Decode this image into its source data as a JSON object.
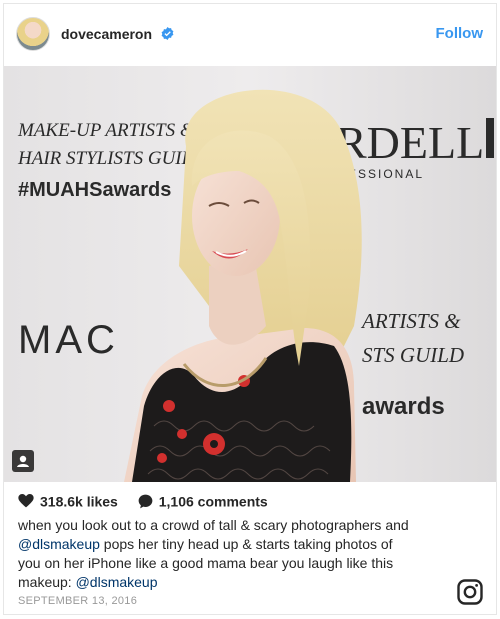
{
  "post": {
    "username": "dovecameron",
    "follow_label": "Follow",
    "likes": "318.6k likes",
    "comments": "1,106 comments",
    "caption_line_1": "when you look out to a crowd of tall & scary photographers and",
    "caption_mention_1": "@dlsmakeup",
    "caption_line_2": " pops her tiny head up & starts taking photos of",
    "caption_line_3": "you on her iPhone like a good mama bear you laugh like this",
    "caption_line_4_prefix": "makeup: ",
    "caption_mention_2": "@dlsmakeup",
    "date": "SEPTEMBER 13, 2016"
  },
  "photo_backdrop": {
    "left_text_1": "MAKE-UP ARTISTS &",
    "left_text_2": "HAIR STYLISTS GUILD",
    "left_text_3": "#MUAHSawards",
    "mac_text": "MAC",
    "top_right_text": "RDELL",
    "top_right_sub": "ESSIONAL",
    "right_text_1": "ARTISTS &",
    "right_text_2": "STS GUILD",
    "right_text_3": "awards"
  },
  "icons": {
    "verified": "verified-badge-icon",
    "heart": "heart-icon",
    "comment": "comment-bubble-icon",
    "tag": "user-tag-icon",
    "instagram": "instagram-logo-icon"
  },
  "colors": {
    "follow": "#3897f0",
    "verified": "#3897f0",
    "text": "#262626",
    "muted": "#999999"
  }
}
